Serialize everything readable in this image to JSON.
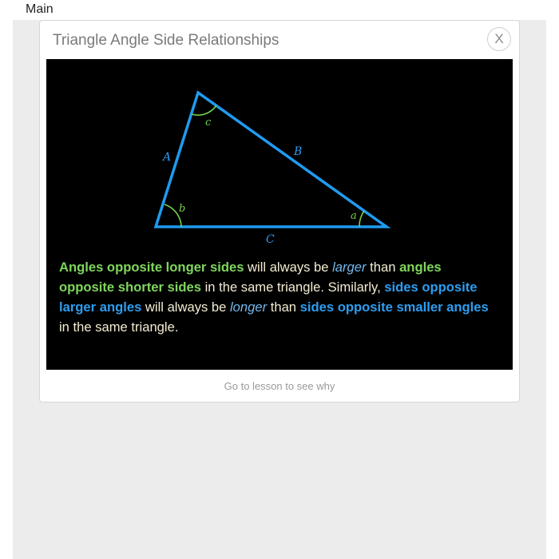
{
  "header": {
    "main_label": "Main"
  },
  "card": {
    "title": "Triangle Angle Side Relationships",
    "close_label": "X",
    "footer_link": "Go to lesson to see why"
  },
  "diagram": {
    "side_labels": {
      "A": "A",
      "B": "B",
      "C": "C"
    },
    "angle_labels": {
      "a": "a",
      "b": "b",
      "c": "c"
    },
    "colors": {
      "sides": "#1f9bf0",
      "angles": "#6fd44e",
      "background": "#000000"
    }
  },
  "text": {
    "p1": "Angles opposite longer sides",
    "p2": " will always be ",
    "p3": "larger",
    "p4": " than ",
    "p5": "angles opposite shorter sides",
    "p6": " in the same triangle. Similarly, ",
    "p7": "sides opposite larger angles",
    "p8": " will always be ",
    "p9": "longer",
    "p10": " than ",
    "p11": "sides opposite smaller angles",
    "p12": " in the same triangle."
  }
}
